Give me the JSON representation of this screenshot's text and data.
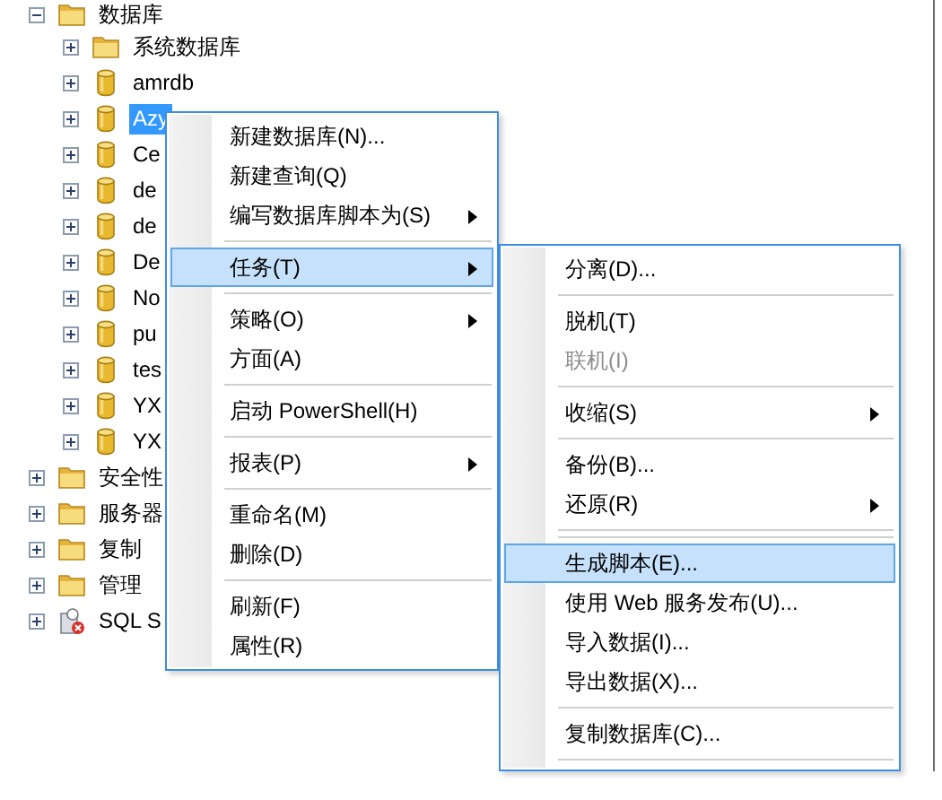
{
  "tree": [
    {
      "label": "数据库",
      "kind": "folder",
      "expanded": true,
      "selected": false,
      "children": [
        {
          "label": "系统数据库",
          "kind": "folder",
          "expanded": false,
          "selected": false
        },
        {
          "label": "amrdb",
          "kind": "database",
          "expanded": false,
          "selected": false
        },
        {
          "label": "Azy",
          "kind": "database",
          "expanded": false,
          "selected": true
        },
        {
          "label": "Ce",
          "kind": "database",
          "expanded": false,
          "selected": false
        },
        {
          "label": "de",
          "kind": "database",
          "expanded": false,
          "selected": false
        },
        {
          "label": "de",
          "kind": "database",
          "expanded": false,
          "selected": false
        },
        {
          "label": "De",
          "kind": "database",
          "expanded": false,
          "selected": false
        },
        {
          "label": "No",
          "kind": "database",
          "expanded": false,
          "selected": false
        },
        {
          "label": "pu",
          "kind": "database",
          "expanded": false,
          "selected": false
        },
        {
          "label": "tes",
          "kind": "database",
          "expanded": false,
          "selected": false
        },
        {
          "label": "YX",
          "kind": "database",
          "expanded": false,
          "selected": false
        },
        {
          "label": "YX",
          "kind": "database",
          "expanded": false,
          "selected": false
        }
      ]
    },
    {
      "label": "安全性",
      "kind": "folder",
      "expanded": false,
      "selected": false
    },
    {
      "label": "服务器",
      "kind": "folder",
      "expanded": false,
      "selected": false
    },
    {
      "label": "复制",
      "kind": "folder",
      "expanded": false,
      "selected": false
    },
    {
      "label": "管理",
      "kind": "folder",
      "expanded": false,
      "selected": false
    },
    {
      "label": "SQL S",
      "kind": "agent",
      "expanded": false,
      "selected": false
    }
  ],
  "context_menu": [
    {
      "kind": "item",
      "label": "新建数据库(N)...",
      "submenu": false,
      "selected": false,
      "disabled": false
    },
    {
      "kind": "item",
      "label": "新建查询(Q)",
      "submenu": false,
      "selected": false,
      "disabled": false
    },
    {
      "kind": "item",
      "label": "编写数据库脚本为(S)",
      "submenu": true,
      "selected": false,
      "disabled": false
    },
    {
      "kind": "separator"
    },
    {
      "kind": "item",
      "label": "任务(T)",
      "submenu": true,
      "selected": true,
      "disabled": false
    },
    {
      "kind": "separator"
    },
    {
      "kind": "item",
      "label": "策略(O)",
      "submenu": true,
      "selected": false,
      "disabled": false
    },
    {
      "kind": "item",
      "label": "方面(A)",
      "submenu": false,
      "selected": false,
      "disabled": false
    },
    {
      "kind": "separator"
    },
    {
      "kind": "item",
      "label": "启动 PowerShell(H)",
      "submenu": false,
      "selected": false,
      "disabled": false
    },
    {
      "kind": "separator"
    },
    {
      "kind": "item",
      "label": "报表(P)",
      "submenu": true,
      "selected": false,
      "disabled": false
    },
    {
      "kind": "separator"
    },
    {
      "kind": "item",
      "label": "重命名(M)",
      "submenu": false,
      "selected": false,
      "disabled": false
    },
    {
      "kind": "item",
      "label": "删除(D)",
      "submenu": false,
      "selected": false,
      "disabled": false
    },
    {
      "kind": "separator"
    },
    {
      "kind": "item",
      "label": "刷新(F)",
      "submenu": false,
      "selected": false,
      "disabled": false
    },
    {
      "kind": "item",
      "label": "属性(R)",
      "submenu": false,
      "selected": false,
      "disabled": false
    }
  ],
  "tasks_submenu": [
    {
      "kind": "item",
      "label": "分离(D)...",
      "submenu": false,
      "selected": false,
      "disabled": false
    },
    {
      "kind": "separator"
    },
    {
      "kind": "item",
      "label": "脱机(T)",
      "submenu": false,
      "selected": false,
      "disabled": false
    },
    {
      "kind": "item",
      "label": "联机(I)",
      "submenu": false,
      "selected": false,
      "disabled": true
    },
    {
      "kind": "separator"
    },
    {
      "kind": "item",
      "label": "收缩(S)",
      "submenu": true,
      "selected": false,
      "disabled": false
    },
    {
      "kind": "separator"
    },
    {
      "kind": "item",
      "label": "备份(B)...",
      "submenu": false,
      "selected": false,
      "disabled": false
    },
    {
      "kind": "item",
      "label": "还原(R)",
      "submenu": true,
      "selected": false,
      "disabled": false
    },
    {
      "kind": "separator"
    },
    {
      "kind": "separator"
    },
    {
      "kind": "item",
      "label": "生成脚本(E)...",
      "submenu": false,
      "selected": true,
      "disabled": false
    },
    {
      "kind": "item",
      "label": "使用 Web 服务发布(U)...",
      "submenu": false,
      "selected": false,
      "disabled": false
    },
    {
      "kind": "item",
      "label": "导入数据(I)...",
      "submenu": false,
      "selected": false,
      "disabled": false
    },
    {
      "kind": "item",
      "label": "导出数据(X)...",
      "submenu": false,
      "selected": false,
      "disabled": false
    },
    {
      "kind": "separator"
    },
    {
      "kind": "item",
      "label": "复制数据库(C)...",
      "submenu": false,
      "selected": false,
      "disabled": false
    },
    {
      "kind": "separator"
    }
  ]
}
